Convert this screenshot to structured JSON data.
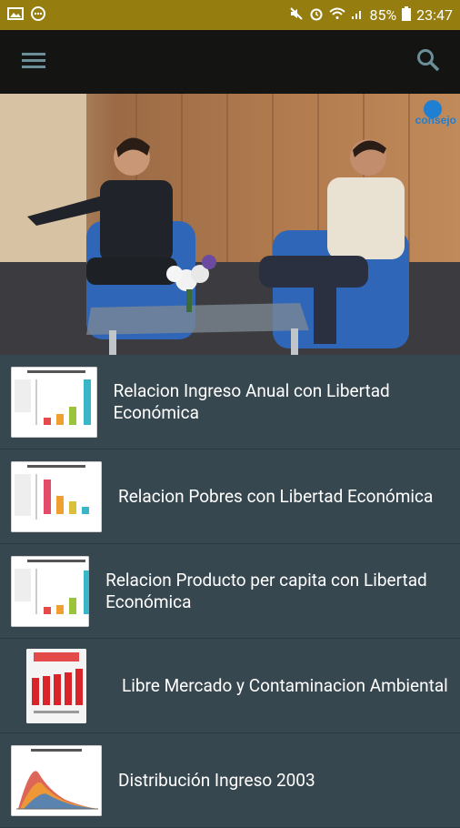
{
  "status_bar": {
    "battery": "85%",
    "time": "23:47"
  },
  "hero": {
    "logo_text": "consejo"
  },
  "items": [
    {
      "title": "Relacion Ingreso Anual con Libertad Económica"
    },
    {
      "title": "Relacion Pobres con Libertad Económica"
    },
    {
      "title": "Relacion Producto per capita con Libertad Económica"
    },
    {
      "title": "Libre Mercado y Contaminacion Ambiental"
    },
    {
      "title": "Distribución Ingreso 2003"
    }
  ]
}
